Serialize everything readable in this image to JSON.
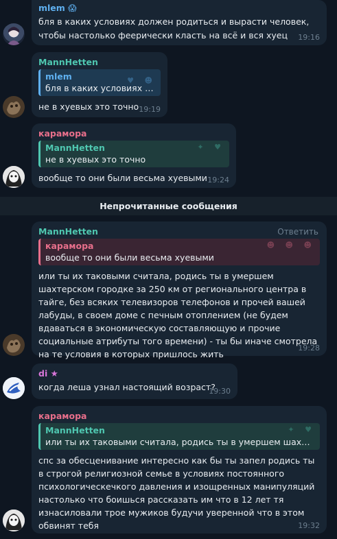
{
  "colors": {
    "background": "#0e1621",
    "bubble": "#182533",
    "mlem": "#5fb0f0",
    "mannhetten": "#4fc7b0",
    "karamora": "#e86f8b",
    "di": "#d776d8",
    "time": "#6d7f8f"
  },
  "msg1": {
    "author": "mlem",
    "author_emoji": "😱",
    "text": "бля в каких условиях должен родиться и вырасти человек, чтобы настолько феерически класть на всё и вся хуец",
    "time": "19:16"
  },
  "msg2": {
    "author": "MannHetten",
    "reply_author": "mlem",
    "reply_text": "бля в каких условиях до...",
    "text": "не в хуевых это точно",
    "time": "19:19"
  },
  "msg3": {
    "author": "карамора",
    "reply_author": "MannHetten",
    "reply_text": "не в хуевых это точно",
    "text": "вообще то они были весьма хуевыми",
    "time": "19:24"
  },
  "unread_label": "Непрочитанные сообщения",
  "msg4": {
    "author": "MannHetten",
    "reply_button": "Ответить",
    "reply_author": "карамора",
    "reply_text": "вообще то они были весьма хуевыми",
    "text": "или ты их таковыми считала, родись ты в умершем шахтерском городке за 250 км от регионального центра в тайге, без всяких телевизоров телефонов и прочей вашей лабуды, в своем доме с печным отоплением (не будем вдаваться в экономическую составляющую и прочие социальные атрибуты того времени) - ты бы иначе смотрела на те условия в которых пришлось жить",
    "time": "19:28"
  },
  "msg5": {
    "author": "di",
    "author_emoji": "★",
    "text": "когда леша узнал настоящий возраст?",
    "time": "19:30"
  },
  "msg6": {
    "author": "карамора",
    "reply_author": "MannHetten",
    "reply_text": "или ты их таковыми считала, родись ты в умершем шахтерс...",
    "text": "спс за обесценивание интересно как бы ты запел родись ты в строгой религиозной семье в условиях постоянного психологическечкого давления и изощренных манипуляций настолько что боишься рассказать им что в 12 лет тя изнасиловали трое мужиков будучи уверенной что в этом обвинят тебя",
    "time": "19:32"
  }
}
